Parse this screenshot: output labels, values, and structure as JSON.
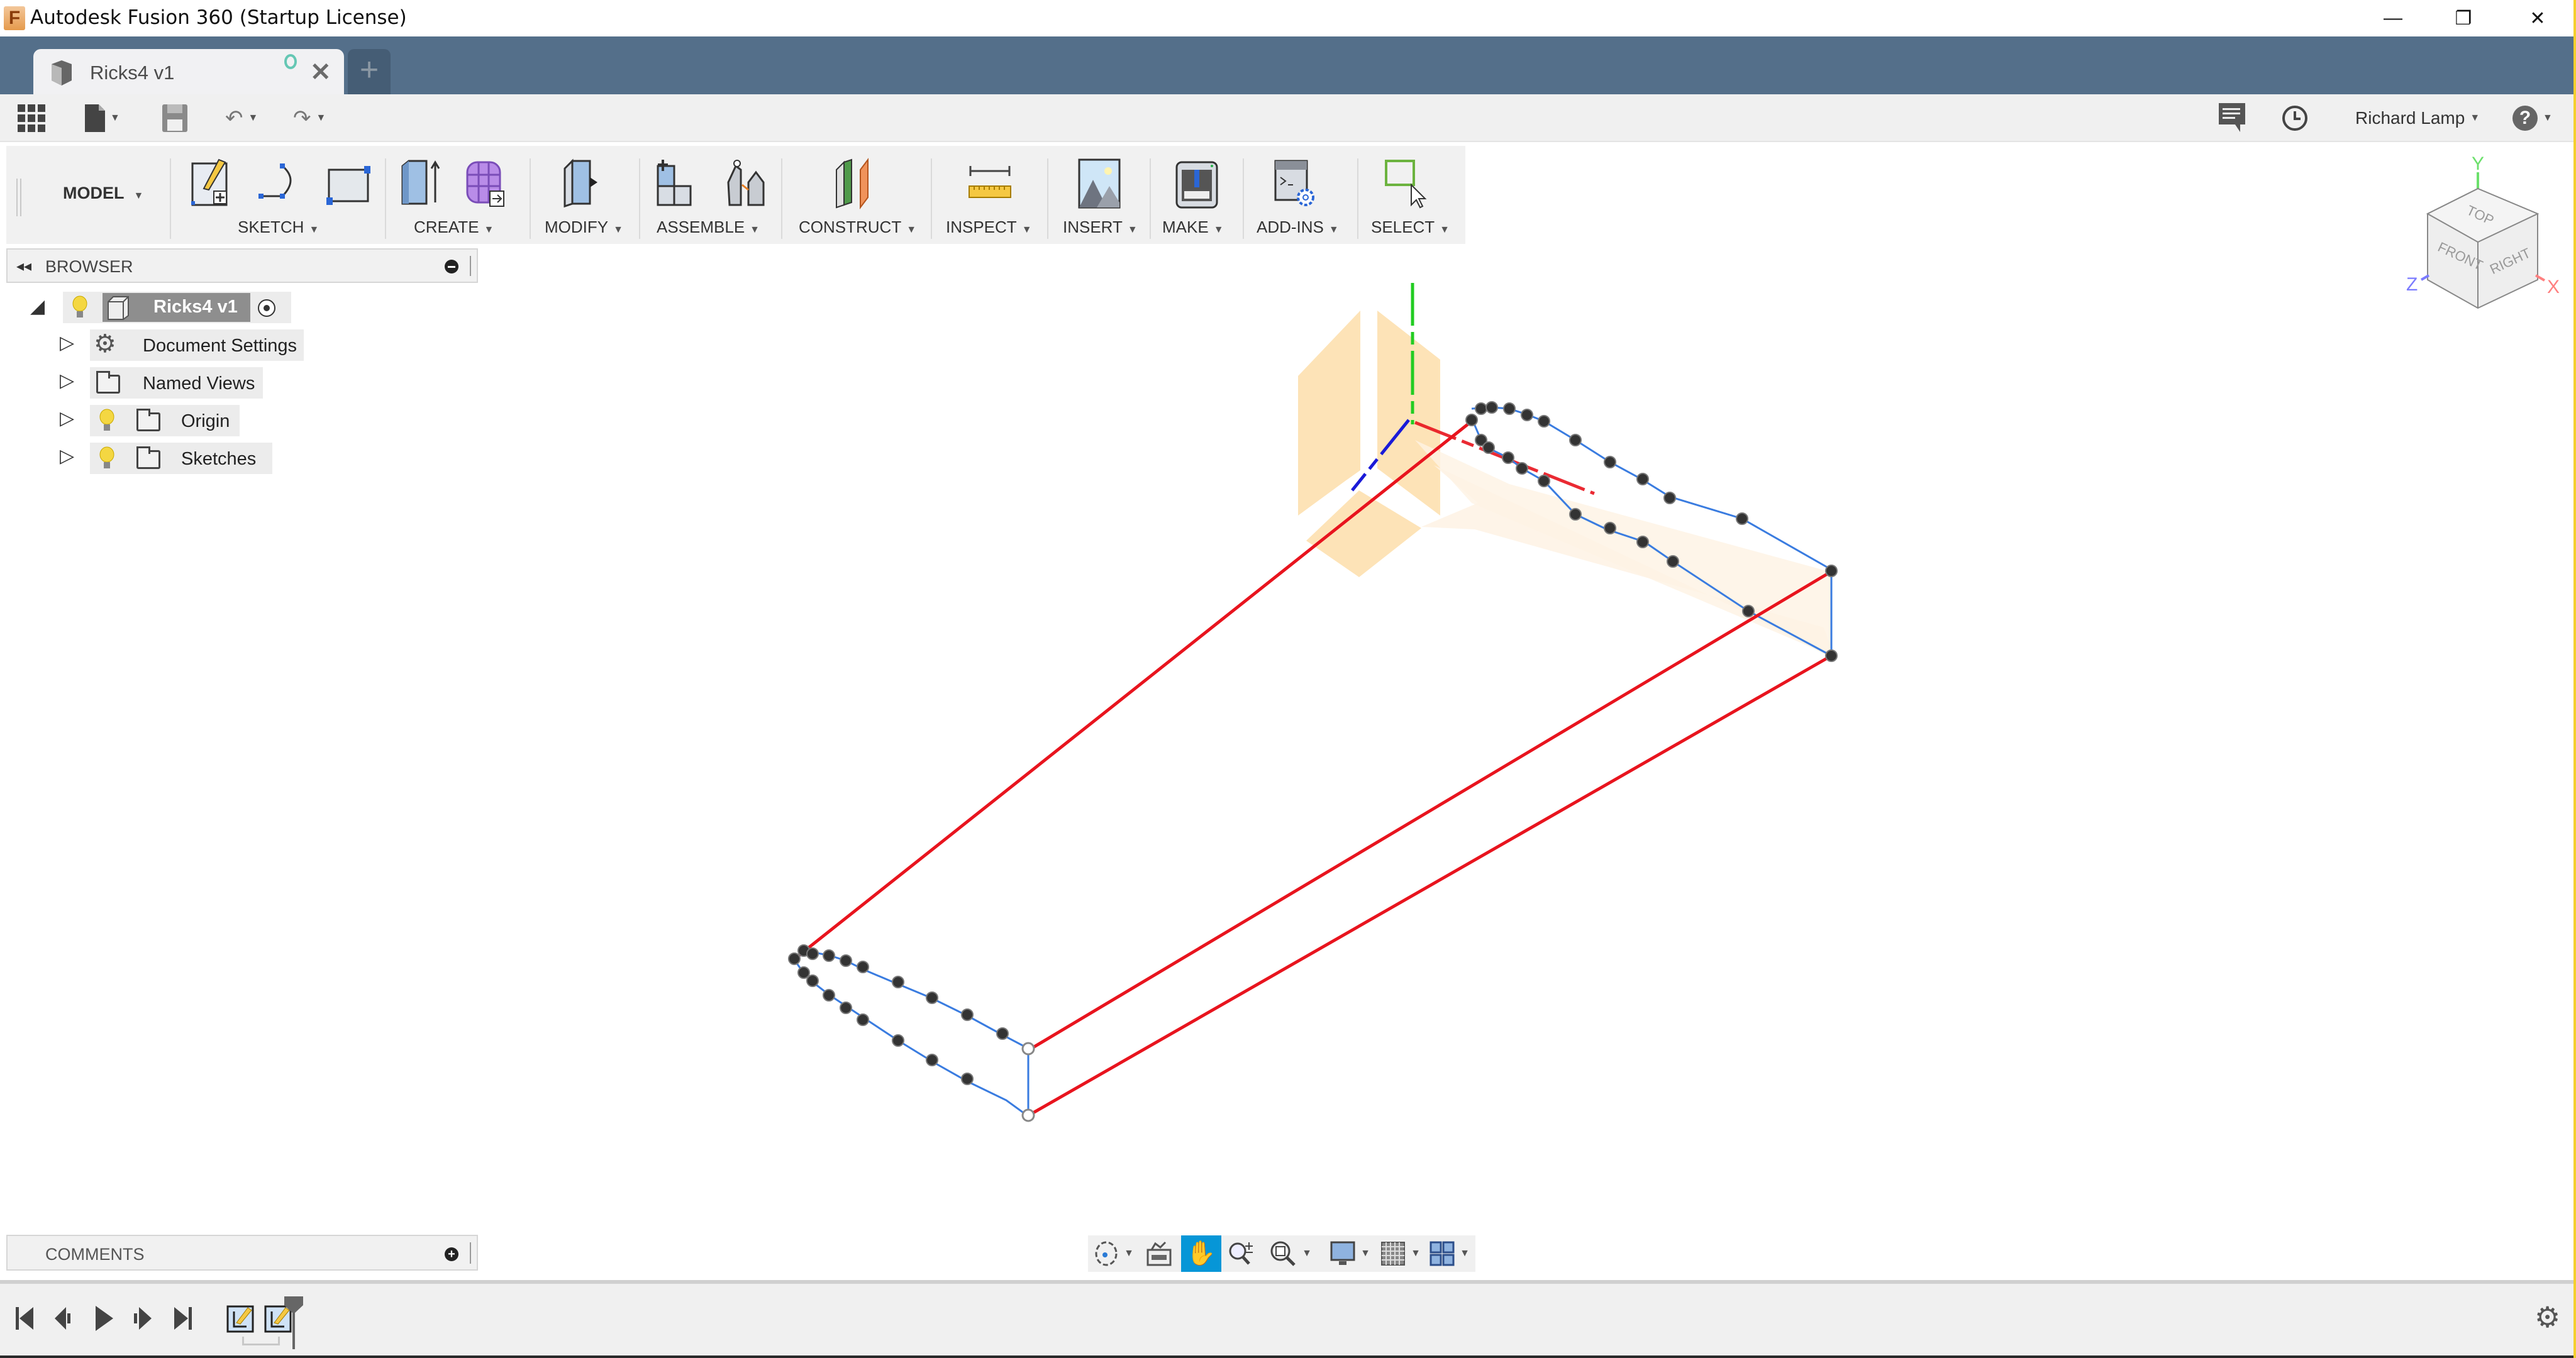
{
  "window": {
    "title": "Autodesk Fusion 360 (Startup License)",
    "app_icon": "F",
    "controls": {
      "minimize": "—",
      "restore": "❐",
      "close": "✕"
    }
  },
  "tabs": {
    "document_tab": {
      "label": "Ricks4 v1",
      "close": "✕"
    },
    "new_tab": "+"
  },
  "quickbar": {
    "user_name": "Richard Lamp",
    "help": "?"
  },
  "toolbar": {
    "workspace": "MODEL",
    "groups": [
      {
        "label": "SKETCH"
      },
      {
        "label": "CREATE"
      },
      {
        "label": "MODIFY"
      },
      {
        "label": "ASSEMBLE"
      },
      {
        "label": "CONSTRUCT"
      },
      {
        "label": "INSPECT"
      },
      {
        "label": "INSERT"
      },
      {
        "label": "MAKE"
      },
      {
        "label": "ADD-INS"
      },
      {
        "label": "SELECT"
      }
    ]
  },
  "browser": {
    "title": "BROWSER",
    "root": {
      "label": "Ricks4 v1"
    },
    "items": [
      {
        "label": "Document Settings",
        "icon": "gear-icon",
        "visible_toggle": false
      },
      {
        "label": "Named Views",
        "icon": "folder-icon",
        "visible_toggle": false
      },
      {
        "label": "Origin",
        "icon": "folder-icon",
        "visible_toggle": true
      },
      {
        "label": "Sketches",
        "icon": "folder-icon",
        "visible_toggle": true
      }
    ]
  },
  "comments": {
    "title": "COMMENTS"
  },
  "viewcube": {
    "top": "TOP",
    "front": "FRONT",
    "right": "RIGHT",
    "x": "X",
    "y": "Y",
    "z": "Z"
  },
  "navbar": {
    "tools": [
      "orbit",
      "look-at",
      "pan",
      "zoom",
      "fit",
      "display-settings",
      "grid-settings",
      "viewports"
    ],
    "active": "pan"
  },
  "timeline": {
    "controls": [
      "first",
      "previous",
      "play",
      "next",
      "last"
    ],
    "features": [
      "sketch-1",
      "sketch-2"
    ]
  },
  "colors": {
    "tabbar": "#546f8a",
    "accent_active": "#0696d7",
    "sketch_profile": "#3a7ce0",
    "rail_lines": "#e8141e",
    "plane_fill": "#fde1b0"
  }
}
